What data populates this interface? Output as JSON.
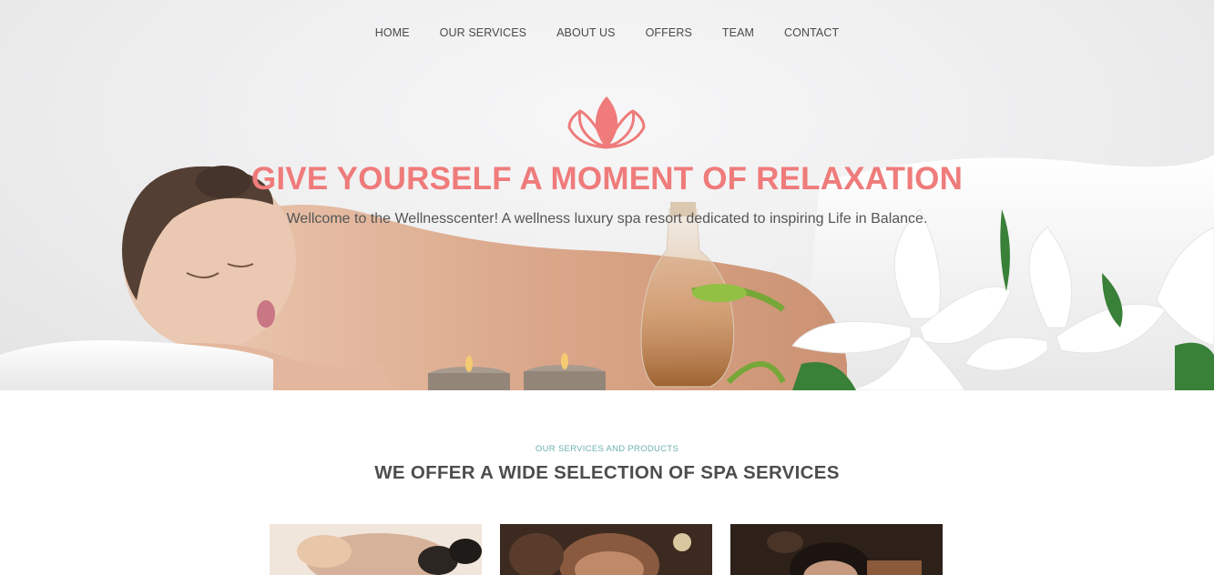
{
  "nav": {
    "items": [
      "HOME",
      "OUR SERVICES",
      "ABOUT US",
      "OFFERS",
      "TEAM",
      "CONTACT"
    ]
  },
  "hero": {
    "icon": "lotus-icon",
    "title": "GIVE YOURSELF A MOMENT OF RELAXATION",
    "subtitle": "Wellcome to the Wellnesscenter! A wellness luxury spa resort dedicated to inspiring Life in Balance."
  },
  "services": {
    "kicker": "OUR SERVICES AND PRODUCTS",
    "title": "WE OFFER A WIDE SELECTION OF SPA SERVICES"
  },
  "colors": {
    "accent": "#ef7b7b",
    "kicker": "#6eb1ad",
    "text": "#4d4d4d"
  }
}
